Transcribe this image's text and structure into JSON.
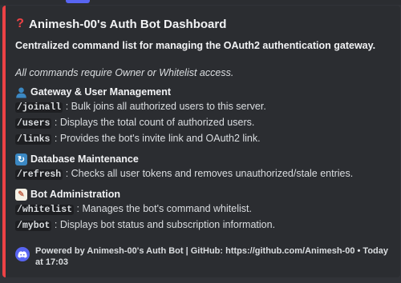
{
  "embed": {
    "accent_color": "#ed4245",
    "title_icon": "question-mark-icon",
    "title": "Animesh-00's Auth Bot Dashboard",
    "description_bold": "Centralized command list for managing the OAuth2 authentication gateway.",
    "description_italic": "All commands require Owner or Whitelist access.",
    "sections": [
      {
        "icon": "user-silhouette-icon",
        "heading": "Gateway & User Management",
        "commands": [
          {
            "name": "/joinall",
            "desc": ": Bulk joins all authorized users to this server."
          },
          {
            "name": "/users",
            "desc": ": Displays the total count of authorized users."
          },
          {
            "name": "/links",
            "desc": ": Provides the bot's invite link and OAuth2 link."
          }
        ]
      },
      {
        "icon": "refresh-icon",
        "heading": "Database Maintenance",
        "commands": [
          {
            "name": "/refresh",
            "desc": ": Checks all user tokens and removes unauthorized/stale entries."
          }
        ]
      },
      {
        "icon": "memo-icon",
        "heading": "Bot Administration",
        "commands": [
          {
            "name": "/whitelist",
            "desc": ": Manages the bot's command whitelist."
          },
          {
            "name": "/mybot",
            "desc": ": Displays bot status and subscription information."
          }
        ]
      }
    ],
    "footer": {
      "icon": "discord-logo-icon",
      "text": "Powered by Animesh-00's Auth Bot | GitHub: https://github.com/Animesh-00 • Today at 17:03"
    }
  }
}
